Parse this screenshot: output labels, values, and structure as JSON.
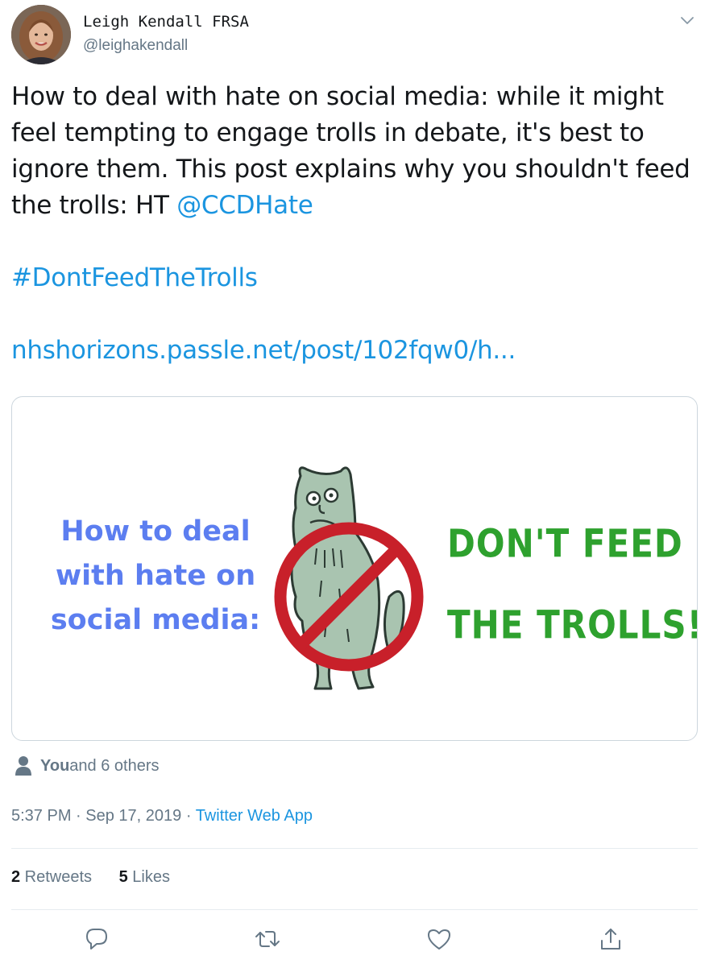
{
  "author": {
    "display_name": "Leigh Kendall FRSA",
    "handle": "@leighakendall"
  },
  "tweet": {
    "line1": "How to deal with hate on social media: while it might",
    "line2": "feel tempting to engage trolls in debate, it's best to",
    "line3": "ignore them. This post explains why you shouldn't feed",
    "line4_text": "the trolls: HT ",
    "mention": "@CCDHate",
    "hashtag": "#DontFeedTheTrolls",
    "url": "nhshorizons.passle.net/post/102fqw0/h..."
  },
  "card": {
    "left_line1": "How to deal",
    "left_line2": "with hate on",
    "left_line3": "social media:",
    "right_line1": "DON'T FEED",
    "right_line2": "THE TROLLS!"
  },
  "likers": {
    "you": "You",
    "others": " and 6 others"
  },
  "meta": {
    "time": "5:37 PM",
    "separator": " · ",
    "date": "Sep 17, 2019",
    "separator2": " · ",
    "source": "Twitter Web App"
  },
  "stats": {
    "retweets_count": "2",
    "retweets_label": " Retweets",
    "likes_count": "5",
    "likes_label": " Likes"
  },
  "icons": {
    "reply": "reply-icon",
    "retweet": "retweet-icon",
    "like": "heart-icon",
    "share": "share-icon",
    "caret": "chevron-down-icon"
  },
  "colors": {
    "link": "#1b95e0",
    "muted": "#657786",
    "card_blue": "#5c7ef0",
    "card_green": "#2ea12e",
    "prohibit_red": "#c8202a"
  }
}
